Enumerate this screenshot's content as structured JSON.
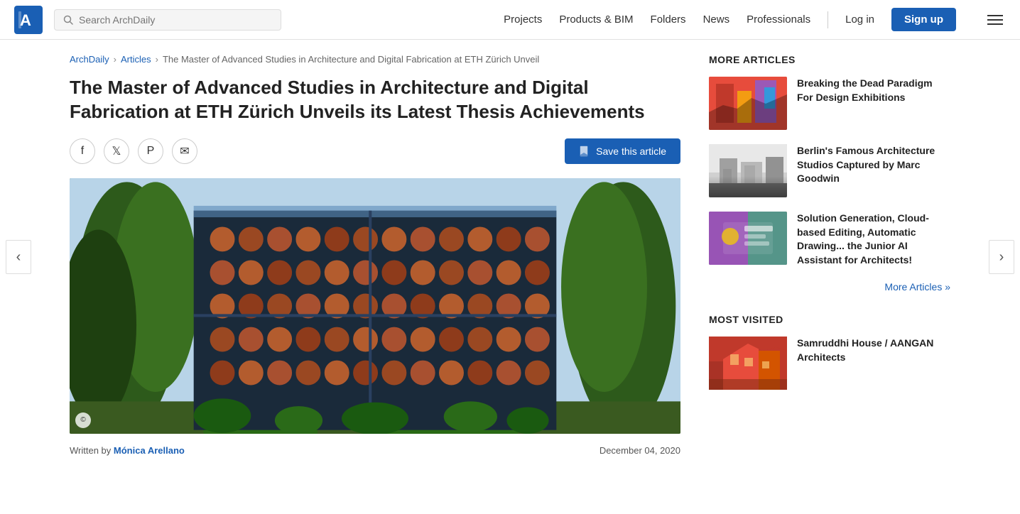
{
  "header": {
    "logo_alt": "ArchDaily",
    "search_placeholder": "Search ArchDaily",
    "nav": [
      {
        "label": "Projects",
        "key": "projects"
      },
      {
        "label": "Products & BIM",
        "key": "products"
      },
      {
        "label": "Folders",
        "key": "folders"
      },
      {
        "label": "News",
        "key": "news"
      },
      {
        "label": "Professionals",
        "key": "professionals"
      }
    ],
    "login_label": "Log in",
    "signup_label": "Sign up"
  },
  "breadcrumb": {
    "home": "ArchDaily",
    "sep1": "›",
    "section": "Articles",
    "sep2": "›",
    "current": "The Master of Advanced Studies in Architecture and Digital Fabrication at ETH Zürich Unveil"
  },
  "article": {
    "title": "The Master of Advanced Studies in Architecture and Digital Fabrication at ETH Zürich Unveils its Latest Thesis Achievements",
    "save_label": "Save this article",
    "written_by_prefix": "Written by",
    "author": "Mónica Arellano",
    "date": "December 04, 2020",
    "copyright_symbol": "©"
  },
  "social": {
    "facebook_icon": "f",
    "twitter_icon": "𝕏",
    "pinterest_icon": "P",
    "email_icon": "✉"
  },
  "sidebar": {
    "more_articles_title": "MORE ARTICLES",
    "articles": [
      {
        "title": "Breaking the Dead Paradigm For Design Exhibitions",
        "img_class": "article-card-img-1"
      },
      {
        "title": "Berlin's Famous Architecture Studios Captured by Marc Goodwin",
        "img_class": "article-card-img-2 interior-photo"
      },
      {
        "title": "Solution Generation, Cloud-based Editing, Automatic Drawing... the Junior AI Assistant for Architects!",
        "img_class": "article-card-img-3"
      }
    ],
    "more_articles_link": "More Articles »",
    "most_visited_title": "MOST VISITED",
    "most_visited": [
      {
        "title": "Samruddhi House / AANGAN Architects",
        "img_class": "visited-card-img"
      }
    ]
  },
  "arrows": {
    "left": "‹",
    "right": "›"
  }
}
